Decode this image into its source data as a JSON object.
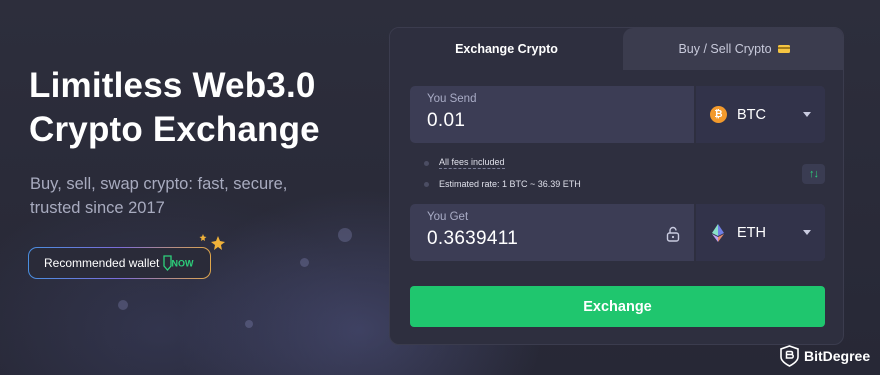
{
  "hero": {
    "title_line1": "Limitless Web3.0",
    "title_line2": "Crypto Exchange",
    "subtitle_line1": "Buy, sell, swap crypto: fast, secure,",
    "subtitle_line2": "trusted since 2017",
    "wallet_badge": "Recommended wallet",
    "now_badge": "NOW"
  },
  "tabs": [
    {
      "label": "Exchange Crypto",
      "active": true
    },
    {
      "label": "Buy / Sell Crypto",
      "active": false
    }
  ],
  "send": {
    "label": "You Send",
    "value": "0.01",
    "currency": "BTC",
    "coin_glyph": "₿"
  },
  "info": {
    "fees": "All fees included",
    "rate": "Estimated rate: 1 BTC ~ 36.39 ETH"
  },
  "swap_glyph": "↑↓",
  "get": {
    "label": "You Get",
    "value": "0.3639411",
    "currency": "ETH"
  },
  "exchange_button": "Exchange",
  "watermark": "BitDegree",
  "colors": {
    "accent_green": "#1fc66e",
    "btc_orange": "#f39a2c",
    "background": "#2a2b39"
  }
}
